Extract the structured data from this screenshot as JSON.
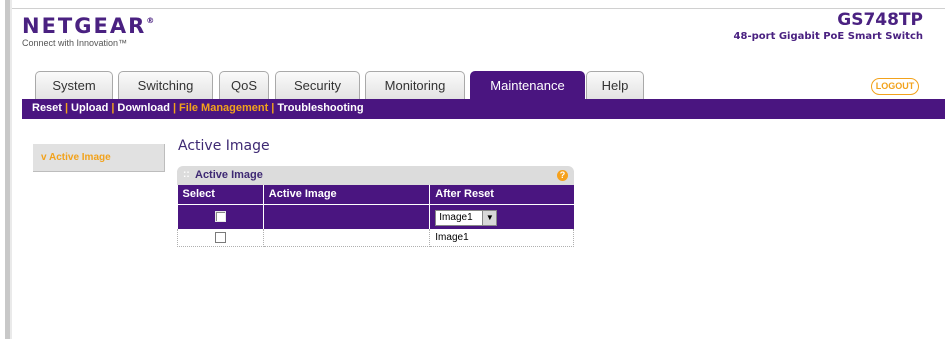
{
  "brand": {
    "logo": "NETGEAR",
    "logo_mark": "®",
    "tagline": "Connect with Innovation™",
    "model_name": "GS748TP",
    "model_desc": "48-port Gigabit PoE Smart Switch"
  },
  "tabs": [
    {
      "label": "System"
    },
    {
      "label": "Switching"
    },
    {
      "label": "QoS"
    },
    {
      "label": "Security"
    },
    {
      "label": "Monitoring"
    },
    {
      "label": "Maintenance"
    },
    {
      "label": "Help"
    }
  ],
  "active_tab": "Maintenance",
  "logout_label": "LOGOUT",
  "subnav": {
    "items": [
      "Reset",
      "Upload",
      "Download",
      "File Management",
      "Troubleshooting"
    ],
    "current": "File Management"
  },
  "sidebar": {
    "items": [
      {
        "label": "Active Image",
        "marker": "v"
      }
    ]
  },
  "page_title": "Active Image",
  "panel": {
    "title": "Active Image",
    "bullet": "::",
    "help_glyph": "?",
    "columns": [
      "Select",
      "Active Image",
      "After Reset"
    ],
    "edit_row": {
      "active_image": "",
      "after_reset_selected": "Image1",
      "dropdown_glyph": "▼"
    },
    "rows": [
      {
        "active_image": "",
        "after_reset": "Image1"
      }
    ]
  },
  "colors": {
    "brand_purple": "#4a1580",
    "accent_orange": "#f2a21b"
  }
}
